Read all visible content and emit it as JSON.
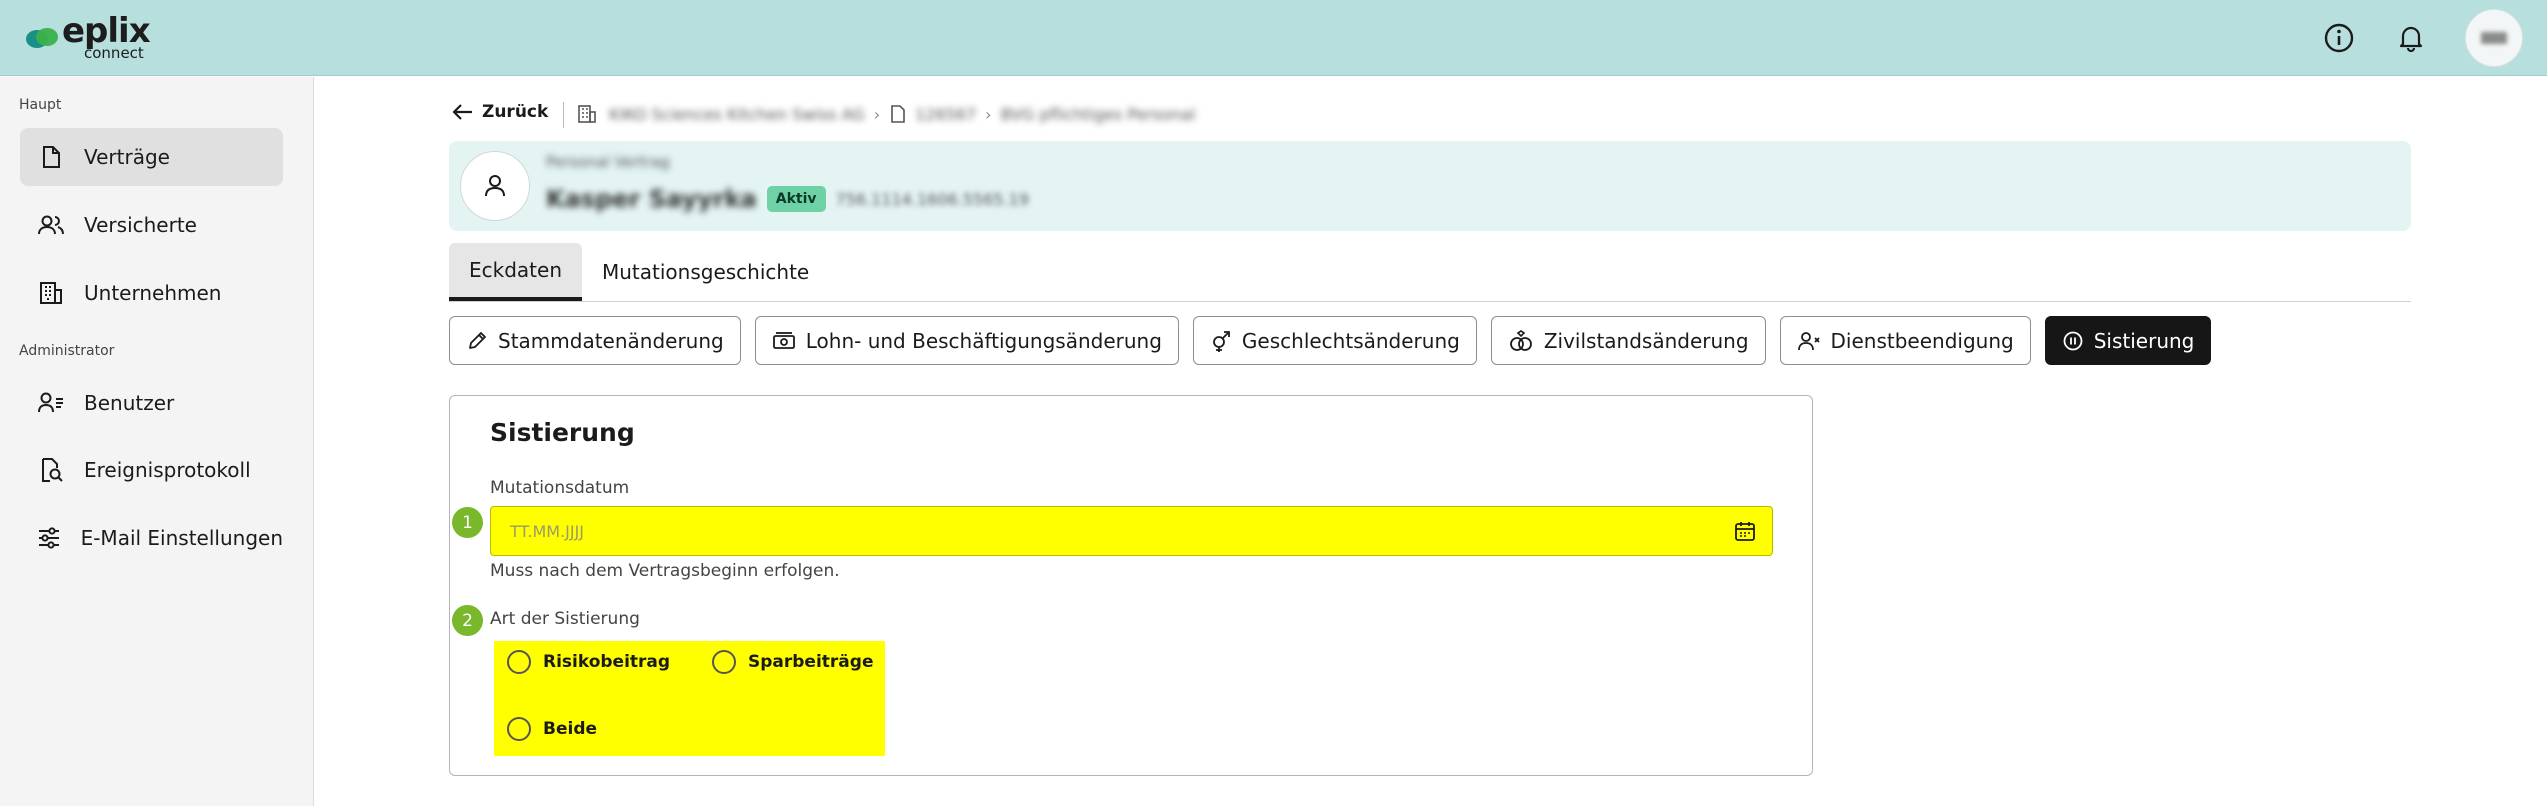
{
  "header": {
    "brand": "eplix",
    "brand_sub": "connect",
    "icons": [
      "info-icon",
      "bell-icon"
    ],
    "avatar_initials": "PM"
  },
  "sidebar": {
    "section_main": "Haupt",
    "section_admin": "Administrator",
    "items": [
      {
        "label": "Verträge",
        "icon": "document-icon",
        "active": true
      },
      {
        "label": "Versicherte",
        "icon": "users-icon"
      },
      {
        "label": "Unternehmen",
        "icon": "building-icon"
      },
      {
        "label": "Benutzer",
        "icon": "user-list-icon"
      },
      {
        "label": "Ereignisprotokoll",
        "icon": "file-search-icon"
      },
      {
        "label": "E-Mail Einstellungen",
        "icon": "sliders-icon"
      }
    ]
  },
  "breadcrumb": {
    "back_label": "Zurück",
    "company": "KIKO Sciences Kitchen Swiss AG",
    "contract_no": "126567",
    "contract_type": "BVG pflichtiges Personal"
  },
  "contract": {
    "type_label": "Personal Vertrag",
    "person_name": "Kasper Sayyrka",
    "status": "Aktiv",
    "ssn": "756.1114.1606.5565.19"
  },
  "tabs": [
    {
      "label": "Eckdaten",
      "active": true
    },
    {
      "label": "Mutationsgeschichte"
    }
  ],
  "actions": [
    {
      "label": "Stammdatenänderung",
      "icon": "pencil-icon"
    },
    {
      "label": "Lohn- und Beschäftigungsänderung",
      "icon": "money-icon"
    },
    {
      "label": "Geschlechtsänderung",
      "icon": "gender-icon"
    },
    {
      "label": "Zivilstandsänderung",
      "icon": "rings-icon"
    },
    {
      "label": "Dienstbeendigung",
      "icon": "user-remove-icon"
    },
    {
      "label": "Sistierung",
      "icon": "pause-icon",
      "active": true
    }
  ],
  "form": {
    "title": "Sistierung",
    "step1": "1",
    "date_label": "Mutationsdatum",
    "date_placeholder": "TT.MM.JJJJ",
    "date_hint": "Muss nach dem Vertragsbeginn erfolgen.",
    "step2": "2",
    "art_label": "Art der Sistierung",
    "options": [
      "Risikobeitrag",
      "Sparbeiträge",
      "Beide"
    ]
  },
  "colors": {
    "header_bg": "#b7dfdd",
    "highlight": "#ffff00",
    "step_badge": "#78b82a",
    "status_badge": "#6fd2a6"
  }
}
